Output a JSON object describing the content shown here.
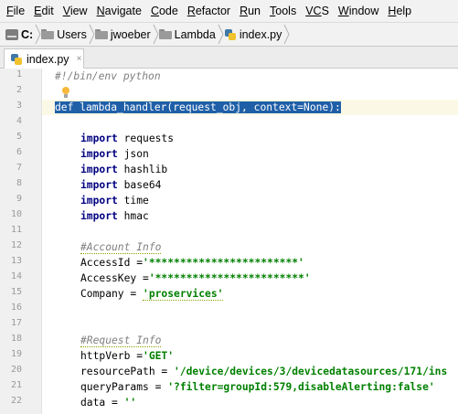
{
  "menu": {
    "items": [
      {
        "mnemonic": "F",
        "rest": "ile"
      },
      {
        "mnemonic": "E",
        "rest": "dit"
      },
      {
        "mnemonic": "V",
        "rest": "iew"
      },
      {
        "mnemonic": "N",
        "rest": "avigate"
      },
      {
        "mnemonic": "C",
        "rest": "ode"
      },
      {
        "mnemonic": "R",
        "rest": "efactor"
      },
      {
        "mnemonic": "R",
        "rest": "un"
      },
      {
        "mnemonic": "T",
        "rest": "ools"
      },
      {
        "mnemonic": "VC",
        "rest": "S"
      },
      {
        "mnemonic": "W",
        "rest": "indow"
      },
      {
        "mnemonic": "H",
        "rest": "elp"
      }
    ]
  },
  "breadcrumb": {
    "items": [
      "C:",
      "Users",
      "jwoeber",
      "Lambda",
      "index.py"
    ]
  },
  "tab": {
    "label": "index.py",
    "close": "×"
  },
  "editor": {
    "line_numbers": [
      "1",
      "2",
      "3",
      "4",
      "5",
      "6",
      "7",
      "8",
      "9",
      "10",
      "11",
      "12",
      "13",
      "14",
      "15",
      "16",
      "17",
      "18",
      "19",
      "20",
      "21",
      "22"
    ],
    "lines": {
      "l1": "#!/bin/env python",
      "l3": "def lambda_handler(request_obj, context=None):",
      "l5_kw": "import",
      "l5_mod": " requests",
      "l6_kw": "import",
      "l6_mod": " json",
      "l7_kw": "import",
      "l7_mod": " hashlib",
      "l8_kw": "import",
      "l8_mod": " base64",
      "l9_kw": "import",
      "l9_mod": " time",
      "l10_kw": "import",
      "l10_mod": " hmac",
      "l12": "#Account Info",
      "l13_var": "AccessId =",
      "l13_str": "'************************'",
      "l14_var": "AccessKey =",
      "l14_str": "'************************'",
      "l15_var": "Company = ",
      "l15_str": "'proservices'",
      "l18": "#Request Info",
      "l19_var": "httpVerb =",
      "l19_str": "'GET'",
      "l20_var": "resourcePath = ",
      "l20_str": "'/device/devices/3/devicedatasources/171/ins",
      "l21_var": "queryParams = ",
      "l21_str": "'?filter=groupId:579,disableAlerting:false'",
      "l22_var": "data = ",
      "l22_str": "''"
    }
  },
  "colors": {
    "keyword": "#000080",
    "string": "#008000",
    "comment": "#808080",
    "selection": "#1f5fa8",
    "caret_row": "#fbf9e6",
    "gutter": "#f0f0f0"
  },
  "icons": {
    "drive": "drive-icon",
    "folder": "folder-icon",
    "file": "python-file-icon",
    "intention": "lightbulb-icon"
  }
}
